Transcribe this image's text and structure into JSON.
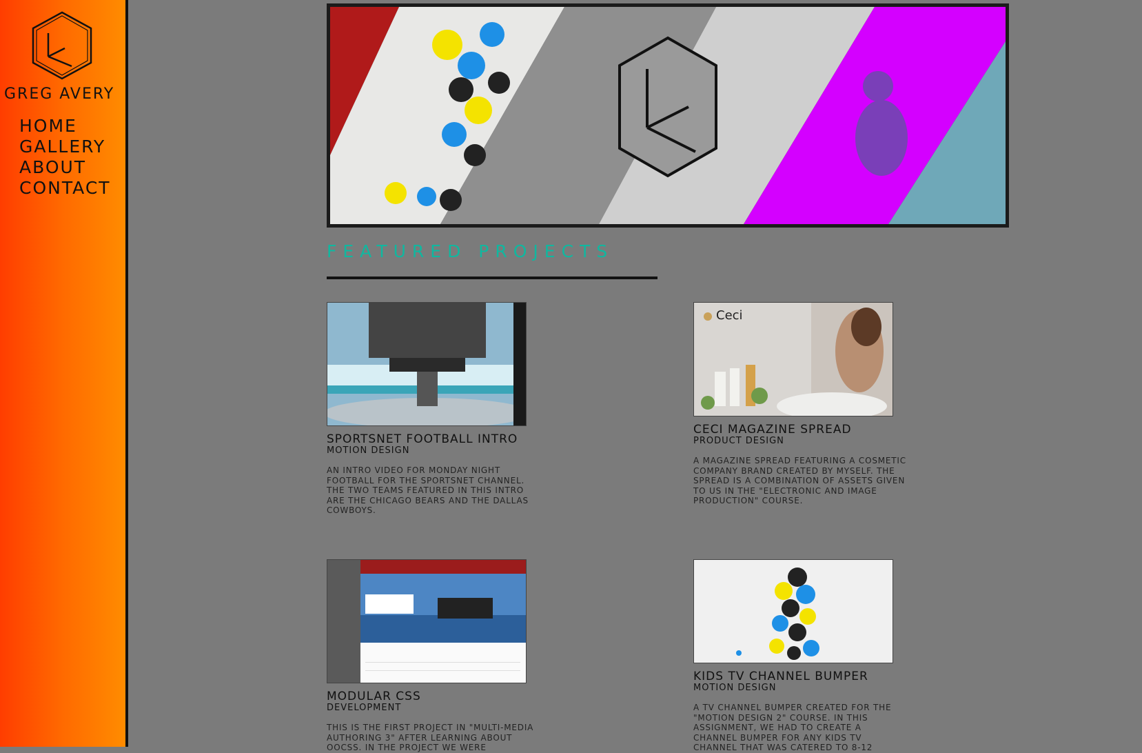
{
  "brand": {
    "name": "Greg Avery",
    "logo_icon": "hexagon-clock-logo-icon"
  },
  "nav": {
    "items": [
      "Home",
      "Gallery",
      "About",
      "Contact"
    ]
  },
  "colors": {
    "sidebar_gradient": [
      "#ff3d00",
      "#ff8c00"
    ],
    "background": "#7b7b7b",
    "accent": "#0fb8a0"
  },
  "banner": {
    "alt": "banner-collage"
  },
  "featured": {
    "title": "Featured Projects"
  },
  "projects": [
    {
      "title": "Sportsnet Football Intro",
      "category": "Motion Design",
      "description": "An intro video for Monday Night Football for the Sportsnet channel. The two teams featured in this intro are the Chicago Bears and the Dallas Cowboys."
    },
    {
      "title": "Ceci Magazine Spread",
      "category": "Product Design",
      "description": "A magazine spread featuring a cosmetic company brand created by myself. The spread is a combination of assets given to us in the \"Electronic and Image Production\" course.",
      "thumb_text": "Ceci"
    },
    {
      "title": "Modular CSS",
      "category": "Development",
      "description": "This is the first project in \"Multi-Media Authoring 3\" after learning about OOCSS. In the project we were"
    },
    {
      "title": "Kids TV Channel Bumper",
      "category": "Motion Design",
      "description": "A TV channel bumper created for the \"Motion Design 2\" course. In this assignment, we had to create a channel bumper for any kids TV channel that was catered to 8-12"
    }
  ]
}
